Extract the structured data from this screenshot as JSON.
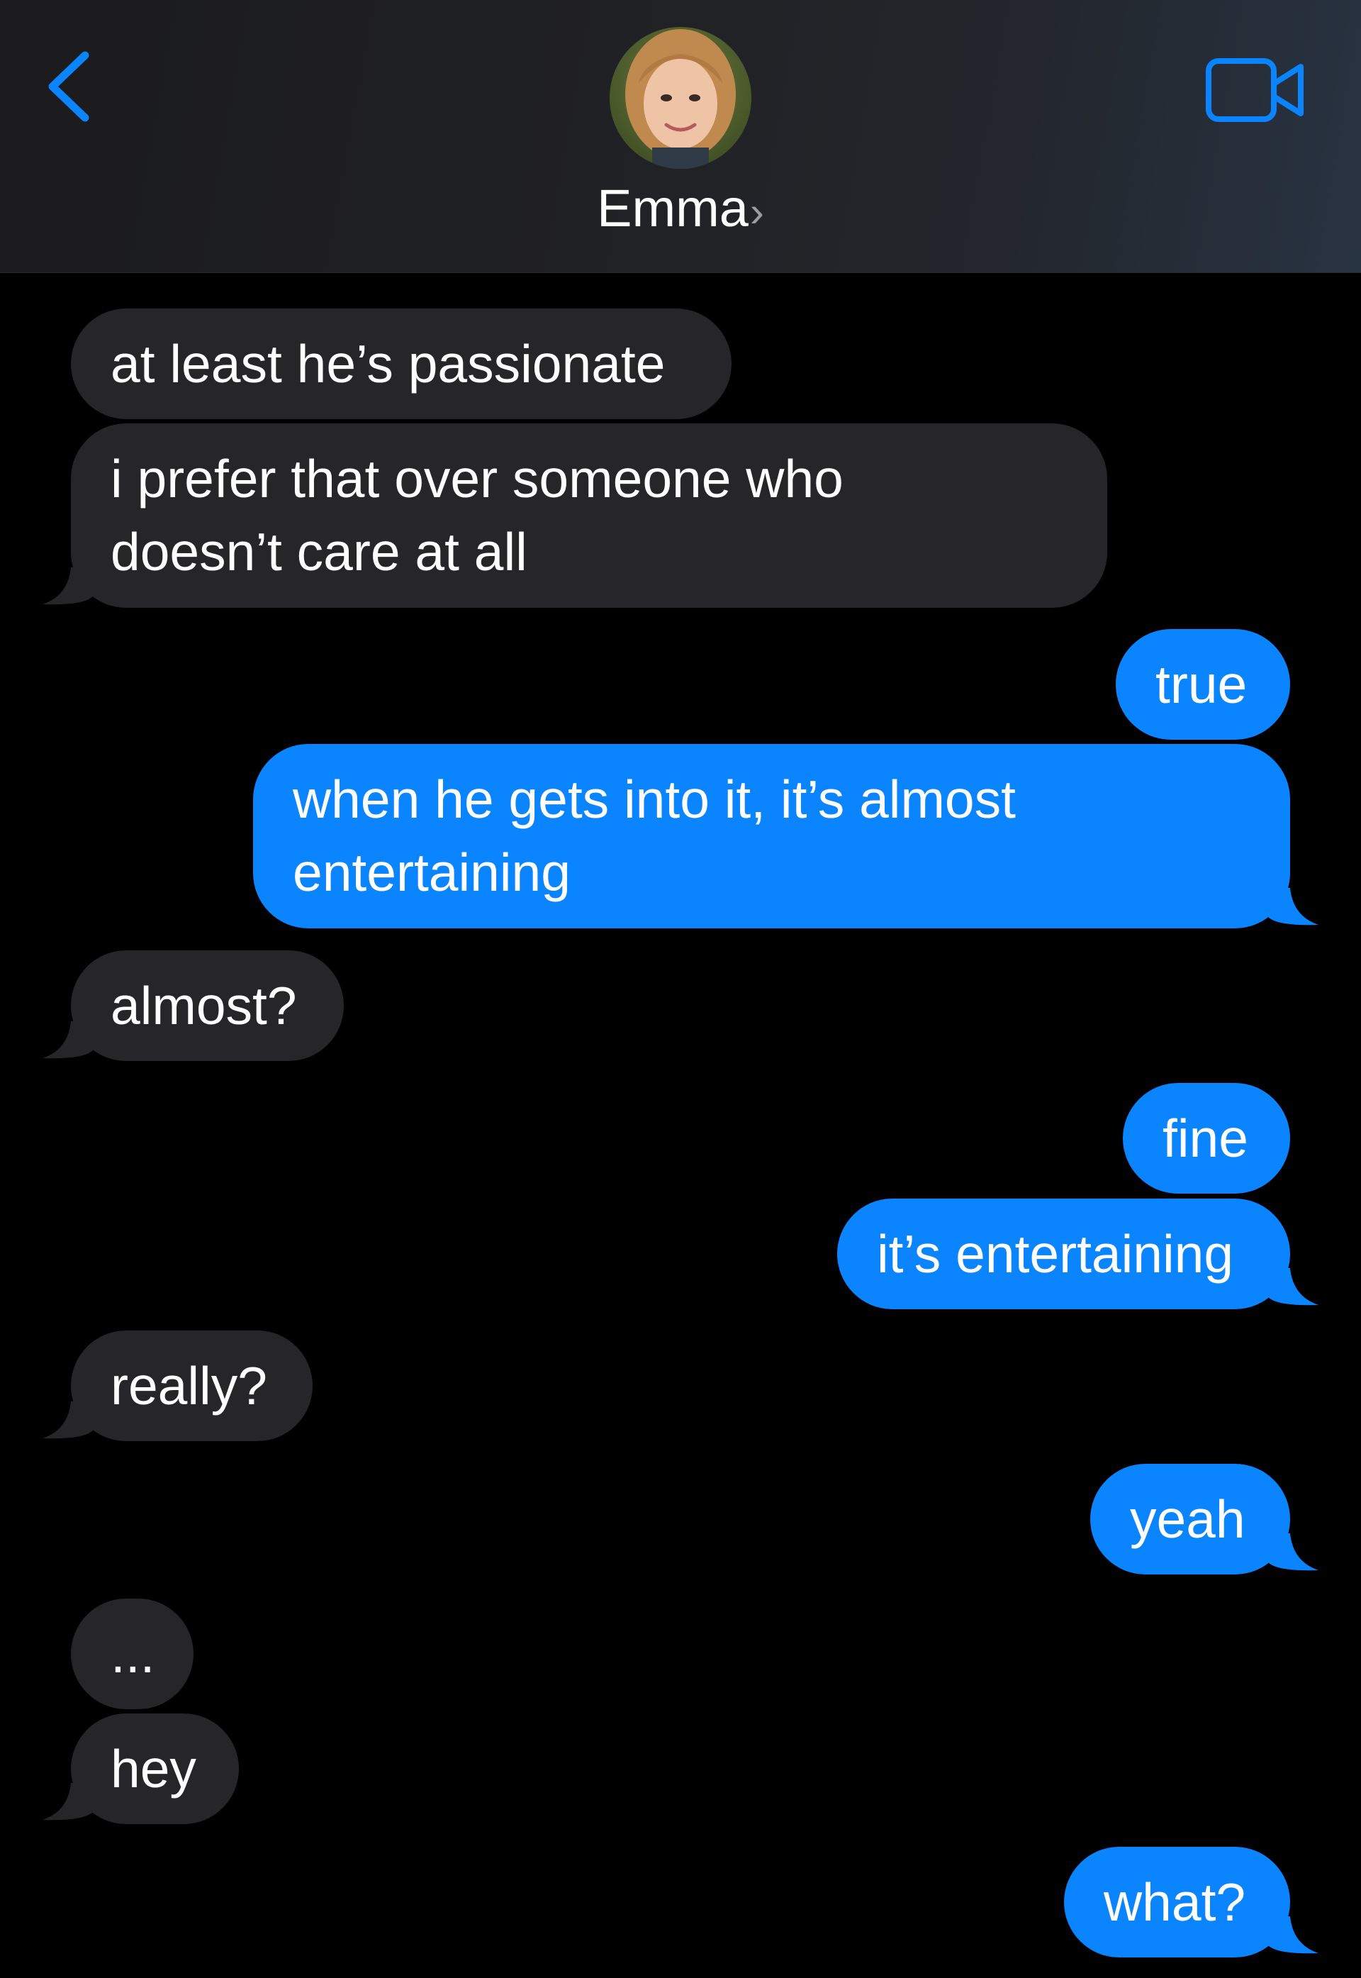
{
  "header": {
    "contact_name": "Emma",
    "chevron": "›",
    "back_icon": "chevron-left-icon",
    "video_icon": "video-camera-icon",
    "accent_color": "#0a84ff"
  },
  "messages": [
    {
      "from": "them",
      "text": "at least he’s passionate"
    },
    {
      "from": "them",
      "lines": [
        "i prefer that over someone who",
        "doesn’t care at all"
      ]
    },
    {
      "from": "me",
      "text": "true"
    },
    {
      "from": "me",
      "lines": [
        "when he gets into it, it’s almost",
        "entertaining"
      ]
    },
    {
      "from": "them",
      "text": "almost?"
    },
    {
      "from": "me",
      "text": "fine"
    },
    {
      "from": "me",
      "text": "it’s entertaining"
    },
    {
      "from": "them",
      "text": "really?"
    },
    {
      "from": "me",
      "text": "yeah"
    },
    {
      "from": "them",
      "text": "..."
    },
    {
      "from": "them",
      "text": "hey"
    },
    {
      "from": "me",
      "text": "what?"
    }
  ],
  "colors": {
    "incoming_bubble": "#262628",
    "outgoing_bubble": "#0a84ff",
    "background": "#000000"
  }
}
